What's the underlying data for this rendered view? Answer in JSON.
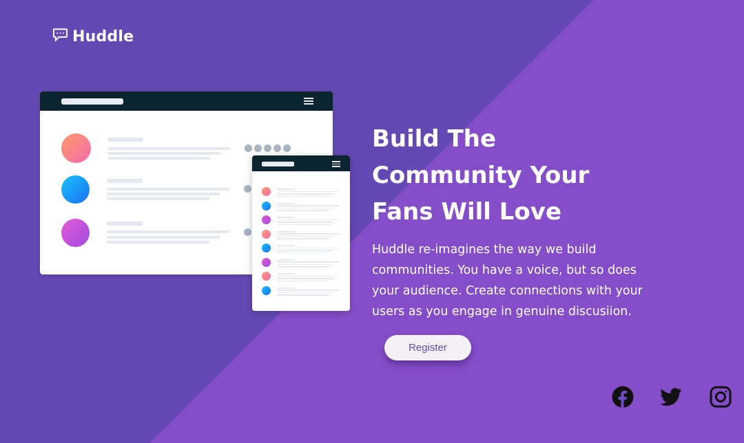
{
  "brand": {
    "name": "Huddle",
    "logo_icon": "chat-bubble-icon"
  },
  "hero": {
    "headline_lines": [
      "Build The",
      "Community Your",
      "Fans Will Love"
    ],
    "description_lines": [
      "Huddle re-imagines the way we build",
      "communities. You have a voice, but so does",
      "your audience. Create connections with your",
      "users as you engage in genuine discusiion."
    ],
    "register_label": "Register"
  },
  "social": [
    "facebook-icon",
    "twitter-icon",
    "instagram-icon"
  ],
  "colors": {
    "background": "#6448b3",
    "diagonal": "#8a4fcc",
    "header_bar": "#0b2530",
    "button_text": "#6448b3"
  }
}
